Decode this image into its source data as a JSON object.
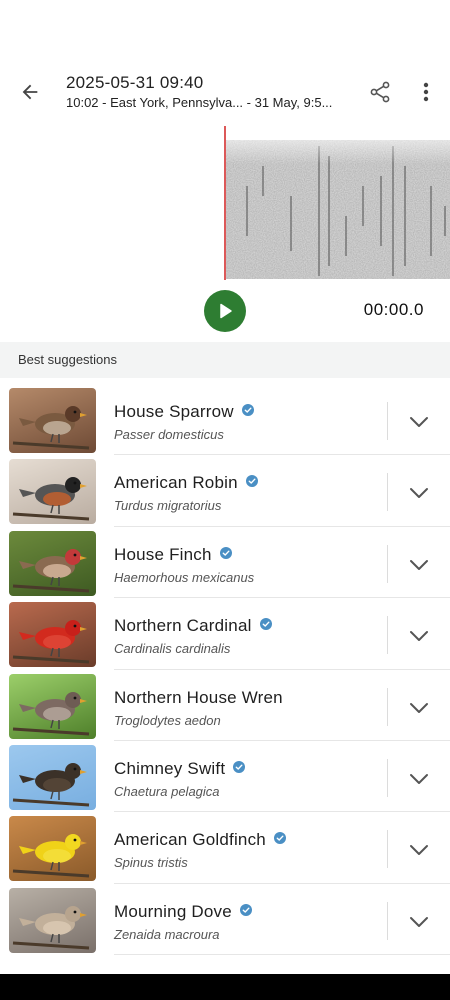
{
  "header": {
    "title": "2025-05-31 09:40",
    "subtitle": "10:02 - East York, Pennsylva... - 31 May, 9:5..."
  },
  "icons": {
    "back": "arrow-back-icon",
    "share": "share-icon",
    "more": "more-vert-icon",
    "play": "play-icon",
    "verified": "verified-badge-icon",
    "expand": "chevron-down-icon"
  },
  "player": {
    "time": "00:00.0",
    "accent": "#2e7d32"
  },
  "section": {
    "title": "Best suggestions"
  },
  "suggestions": [
    {
      "common": "House Sparrow",
      "scientific": "Passer domesticus",
      "verified": true
    },
    {
      "common": "American Robin",
      "scientific": "Turdus migratorius",
      "verified": true
    },
    {
      "common": "House Finch",
      "scientific": "Haemorhous mexicanus",
      "verified": true
    },
    {
      "common": "Northern Cardinal",
      "scientific": "Cardinalis cardinalis",
      "verified": true
    },
    {
      "common": "Northern House Wren",
      "scientific": "Troglodytes aedon",
      "verified": false
    },
    {
      "common": "Chimney Swift",
      "scientific": "Chaetura pelagica",
      "verified": true
    },
    {
      "common": "American Goldfinch",
      "scientific": "Spinus tristis",
      "verified": true
    },
    {
      "common": "Mourning Dove",
      "scientific": "Zenaida macroura",
      "verified": true
    }
  ],
  "colors": {
    "verified": "#4a8fc4",
    "cursor": "#d32f2f"
  }
}
